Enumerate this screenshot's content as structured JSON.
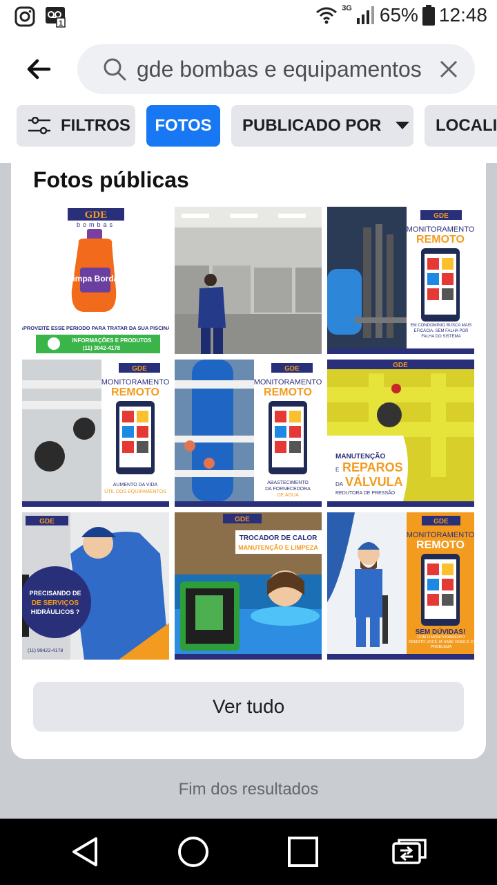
{
  "status_bar": {
    "left_icons": [
      "instagram-icon",
      "voicemail-notification-icon"
    ],
    "voicemail_badge": "1",
    "network_label": "3G",
    "battery": "65%",
    "time": "12:48"
  },
  "search": {
    "query": "gde bombas e equipamentos",
    "back_icon": "back-arrow-icon",
    "clear_icon": "close-icon"
  },
  "filters": {
    "filtros_label": "FILTROS",
    "fotos_label": "FOTOS",
    "publicado_label": "PUBLICADO POR",
    "localizacao_label": "LOCALIZAÇÃO"
  },
  "photos_section": {
    "title": "Fotos públicas",
    "see_all_label": "Ver tudo",
    "logo_text": "GDE",
    "logo_sub": "bombas",
    "tiles": {
      "t1": {
        "product": "Limpa Bordas",
        "caption": "APROVEITE ESSE PERIODO PARA TRATAR DA SUA PISCINA",
        "info": "INFORMAÇÕES E PRODUTOS",
        "phone": "(11) 3042-4178"
      },
      "t3": {
        "line1": "MONITORAMENTO",
        "line2": "REMOTO",
        "footer": "EM CONDOMÍNIO BUSCA MAIS EFICÁCIA, SEM FALHA POR FALHA DO SISTEMA"
      },
      "t4": {
        "line1": "MONITORAMENTO",
        "line2": "REMOTO",
        "footer1": "AUMENTO DA VIDA",
        "footer2": "ÚTIL DOS EQUIPAMENTOS"
      },
      "t5": {
        "line1": "MONITORAMENTO",
        "line2": "REMOTO",
        "footer1": "ABASTECIMENTO",
        "footer2": "DA FORNECEDORA",
        "footer3": "DE ÁGUA"
      },
      "t6": {
        "line1": "MANUTENÇÃO",
        "line2": "REPAROS",
        "line3": "VÁLVULA",
        "line4": "REDUTORA DE PRESSÃO",
        "e": "E",
        "da": "DA"
      },
      "t7": {
        "line1": "PRECISANDO DE",
        "line2": "DE SERVIÇOS",
        "line3": "HIDRÁULICOS ?",
        "phone": "(11) 99422-4178"
      },
      "t8": {
        "line1": "TROCADOR DE CALOR",
        "line2": "MANUTENÇÃO E LIMPEZA"
      },
      "t9": {
        "line1": "MONITORAMENTO",
        "line2": "REMOTO",
        "line3": "SEM DÚVIDAS!",
        "line4": "COM O MONITORAMENTO REMOTO VOCÊ JÁ SABE ONDE É O PROBLEMA"
      }
    }
  },
  "end_of_results": "Fim dos resultados",
  "colors": {
    "accent": "#1877f2",
    "chip_bg": "#e4e6eb",
    "orange": "#f39b1f",
    "navy": "#2a2f7a"
  }
}
